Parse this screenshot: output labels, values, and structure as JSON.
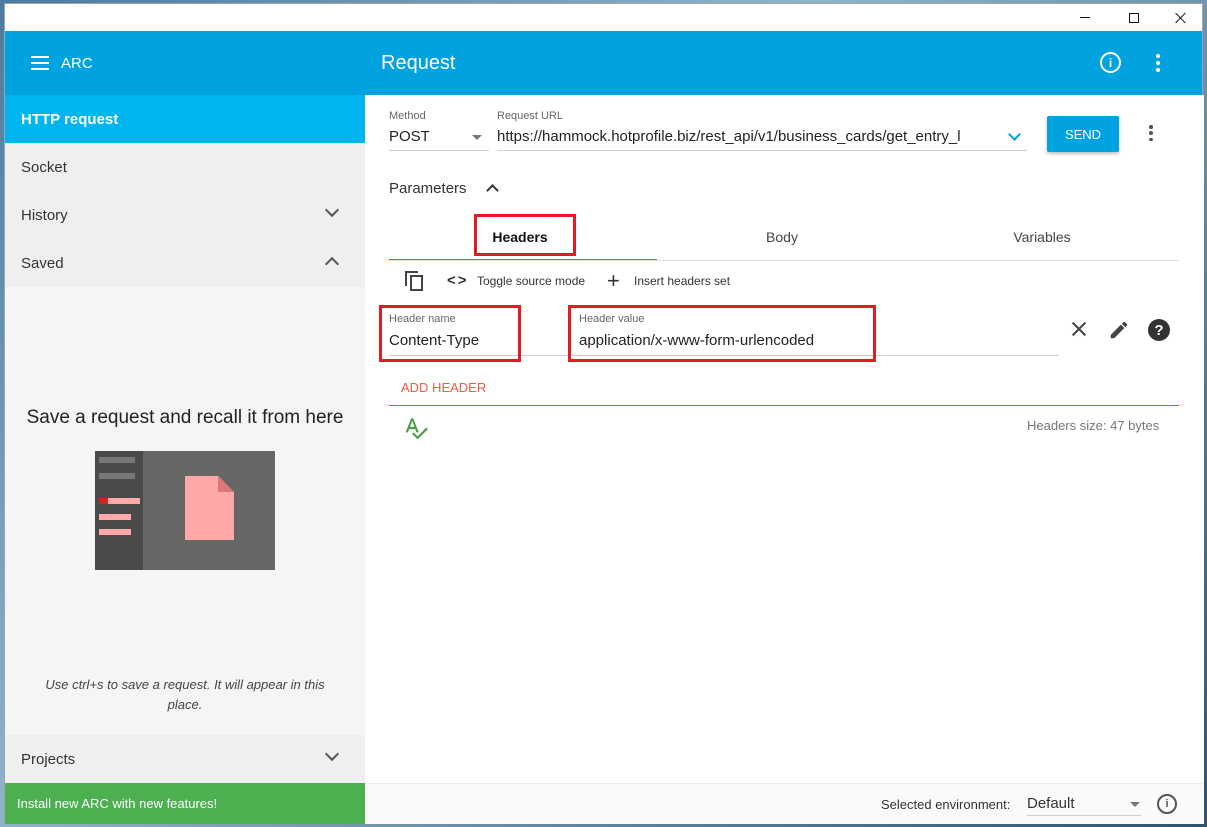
{
  "window": {
    "controls": {
      "minimize": "minimize-icon",
      "maximize": "maximize-icon",
      "close": "close-icon"
    }
  },
  "appbar": {
    "app_name": "ARC",
    "title": "Request",
    "icons": [
      "menu-icon",
      "info-icon",
      "more-vert-icon"
    ]
  },
  "sidebar": {
    "items": [
      {
        "label": "HTTP request",
        "active": true
      },
      {
        "label": "Socket"
      },
      {
        "label": "History",
        "chevron": "down"
      },
      {
        "label": "Saved",
        "chevron": "up"
      }
    ],
    "saved_empty": {
      "title": "Save a request and recall it from here",
      "hint": "Use ctrl+s to save a request. It will appear in this place."
    },
    "projects": {
      "label": "Projects",
      "chevron": "down"
    },
    "install_banner": "Install new ARC with new features!"
  },
  "request": {
    "method_label": "Method",
    "method": "POST",
    "url_label": "Request URL",
    "url": "https://hammock.hotprofile.biz/rest_api/v1/business_cards/get_entry_l",
    "send": "SEND",
    "parameters_label": "Parameters",
    "tabs": [
      {
        "label": "Headers",
        "active": true
      },
      {
        "label": "Body"
      },
      {
        "label": "Variables"
      }
    ],
    "toolbar": {
      "toggle_source": "Toggle source mode",
      "insert_set": "Insert headers set"
    },
    "header": {
      "name_label": "Header name",
      "name": "Content-Type",
      "value_label": "Header value",
      "value": "application/x-www-form-urlencoded"
    },
    "add_header": "ADD HEADER",
    "headers_size": "Headers size: 47 bytes"
  },
  "footer": {
    "env_label": "Selected environment:",
    "env_value": "Default"
  },
  "colors": {
    "primary": "#00a2e0",
    "active_nav": "#00b4f0",
    "install_banner": "#4caf50",
    "highlight": "#e31b23",
    "add_header": "#e85c4a"
  }
}
